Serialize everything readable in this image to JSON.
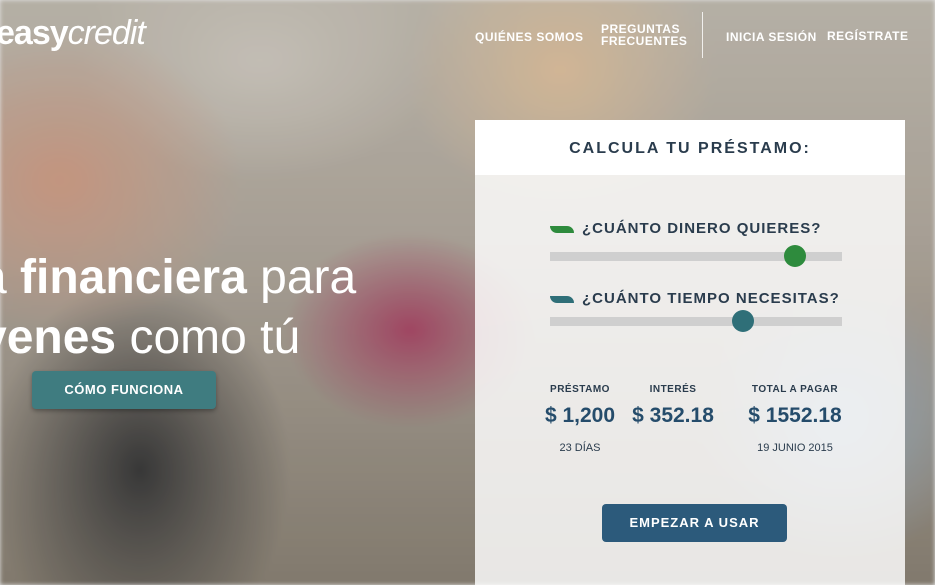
{
  "brand": {
    "easy": "easy",
    "credit": "credit"
  },
  "nav": {
    "about": "QUIÉNES SOMOS",
    "faq_line1": "PREGUNTAS",
    "faq_line2": "FRECUENTES",
    "login": "INICIA SESIÓN",
    "register": "REGÍSTRATE"
  },
  "hero": {
    "line1_a": "a ",
    "line1_b": "financiera",
    "line1_c": " para",
    "line2_a": "venes",
    "line2_b": " como tú",
    "cta": "CÓMO FUNCIONA"
  },
  "calculator": {
    "title": "CALCULA TU PRÉSTAMO:",
    "q_amount": "¿CUÁNTO DINERO QUIERES?",
    "q_time": "¿CUÁNTO TIEMPO NECESITAS?",
    "amount_slider_level": 0.84,
    "time_slider_level": 0.66,
    "loan_label": "PRÉSTAMO",
    "loan_value": "$ 1,200",
    "loan_sub": "23 DÍAS",
    "interest_label": "INTERÉS",
    "interest_value": "$ 352.18",
    "total_label": "TOTAL A PAGAR",
    "total_value": "$ 1552.18",
    "total_sub": "19 JUNIO 2015",
    "start_button": "EMPEZAR A USAR"
  },
  "colors": {
    "amount_accent": "#2e8b3d",
    "time_accent": "#2f6f78",
    "primary_button": "#2c5a7b",
    "cta_button": "#3f7c80",
    "title_text": "#2a3c4d"
  },
  "icons": {
    "amount": "leaf-icon",
    "time": "leaf-icon"
  }
}
